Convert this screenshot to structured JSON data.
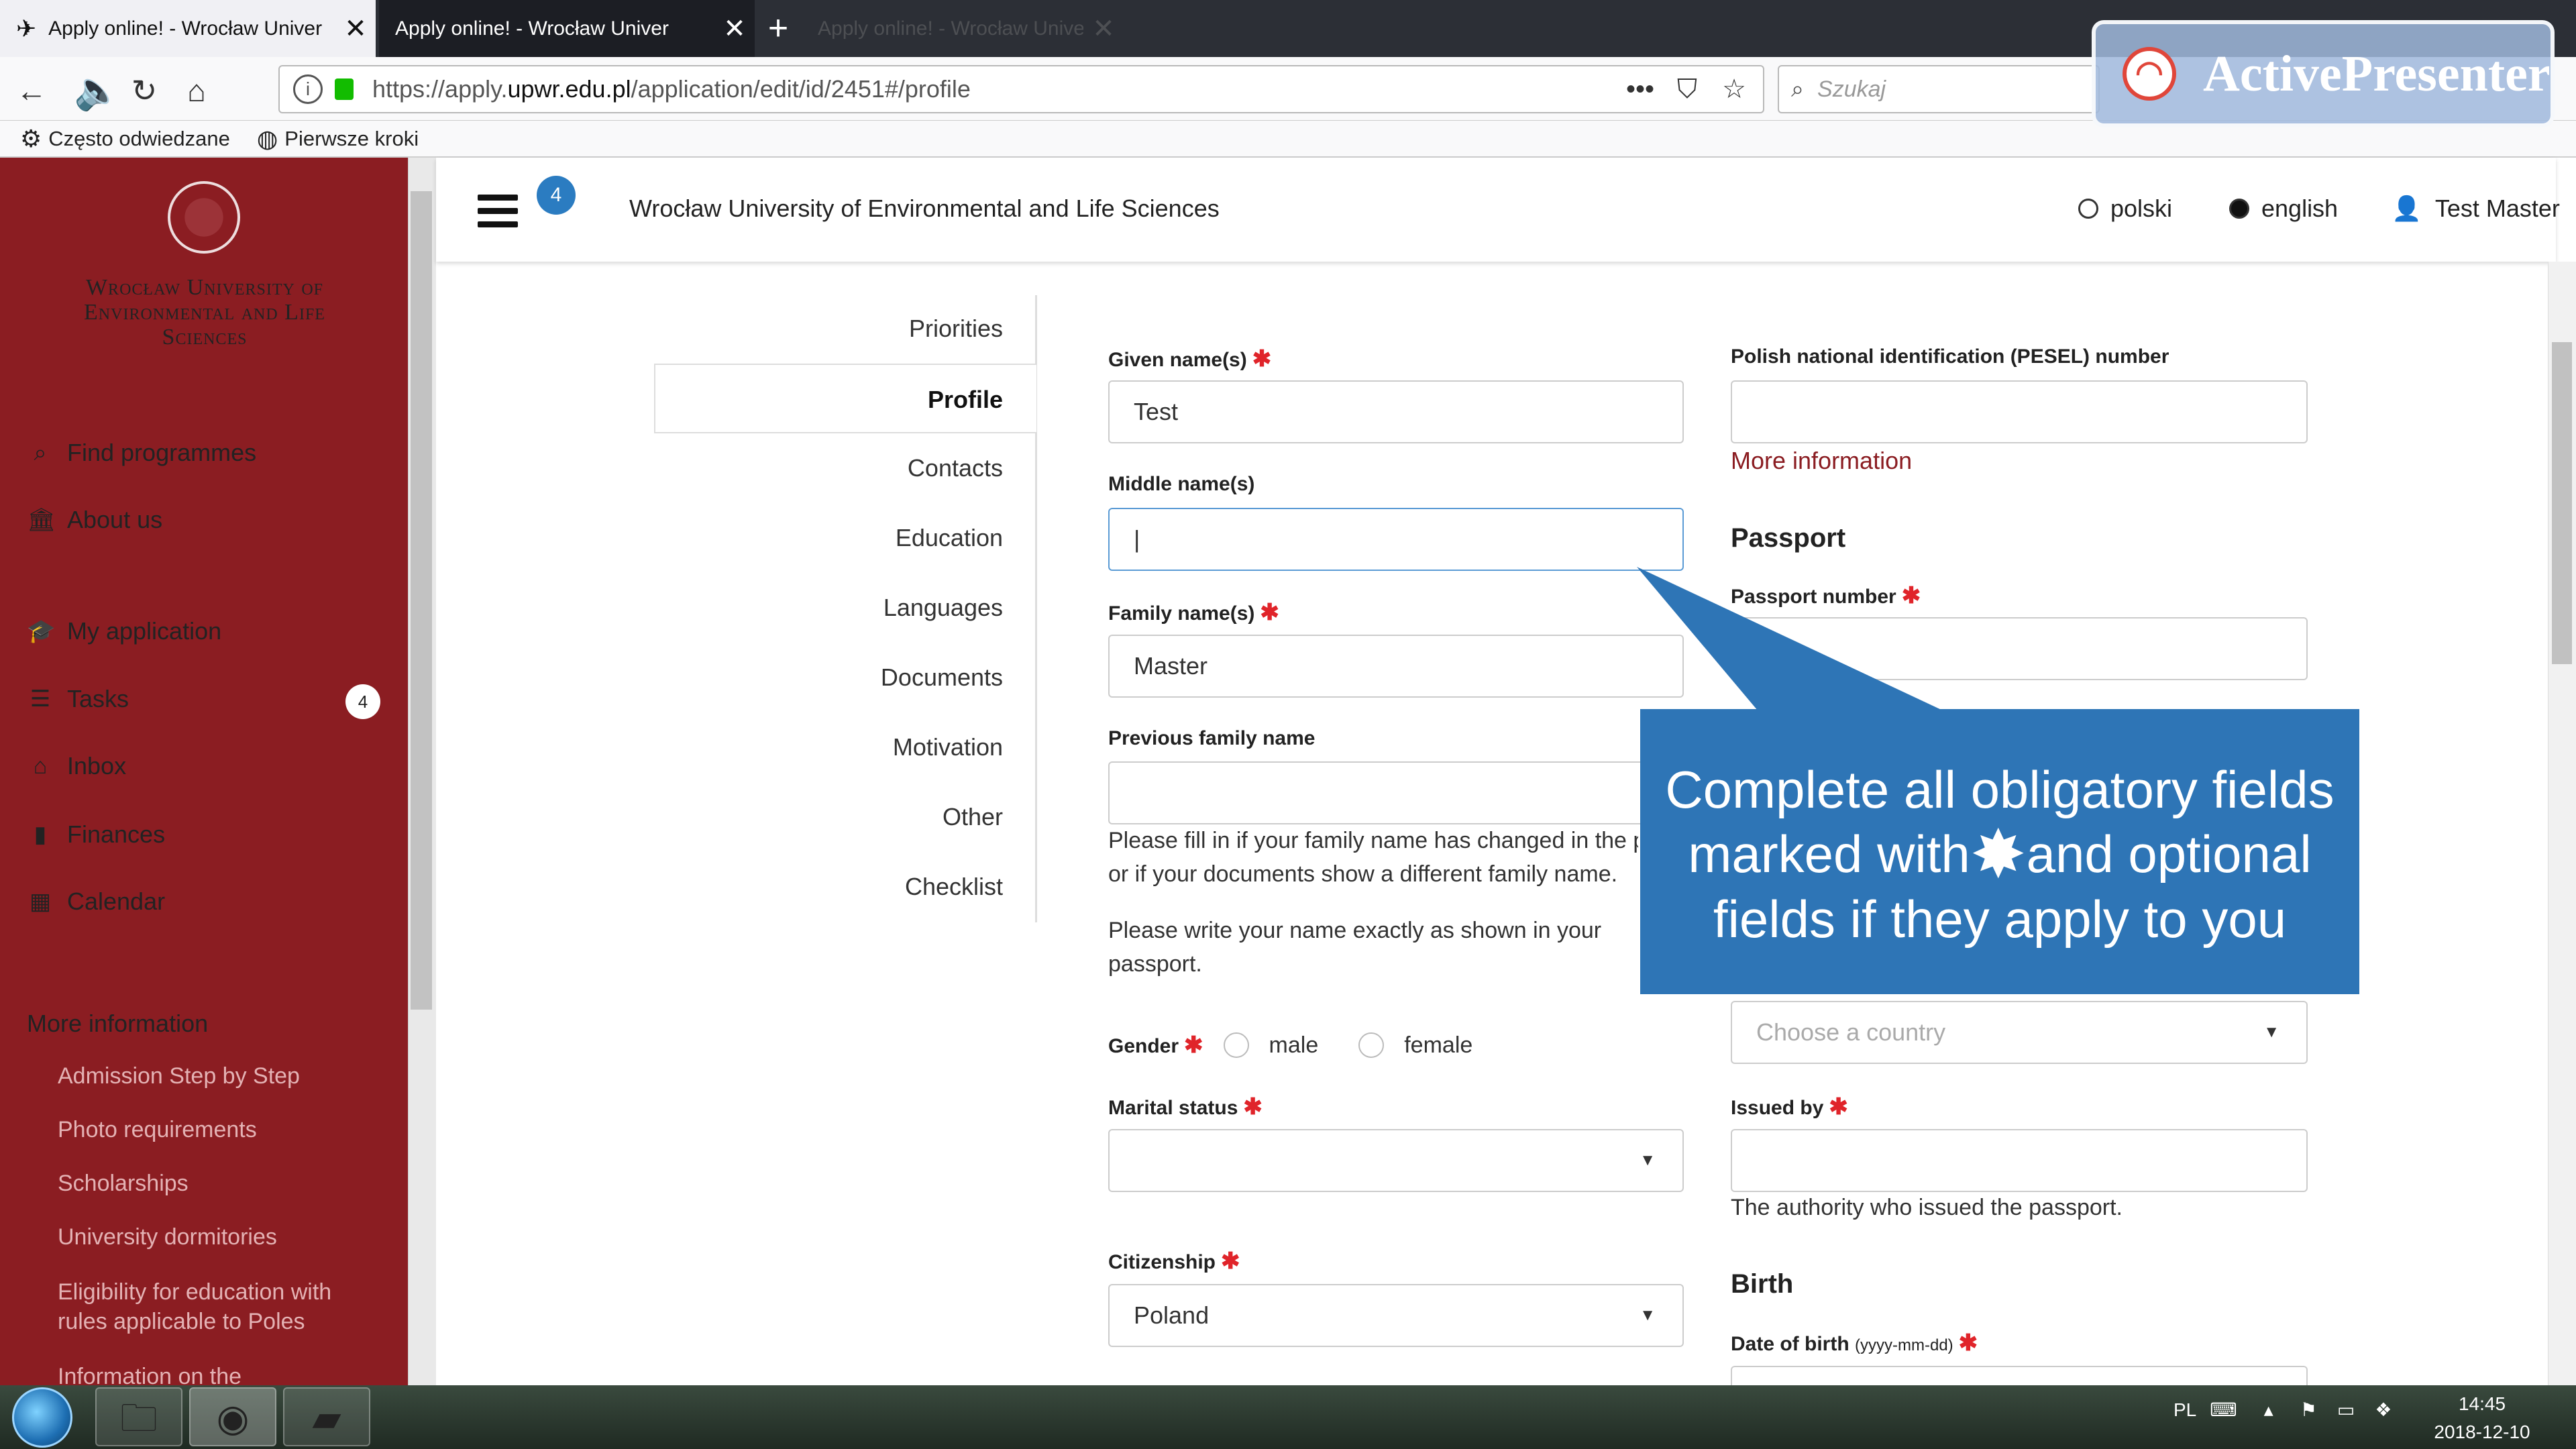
{
  "browser": {
    "tabs": [
      {
        "title": "Apply online! - Wrocław Univer",
        "close": "✕"
      },
      {
        "title": "Apply online! - Wrocław Univer",
        "close": "✕"
      },
      {
        "title": "Apply online! - Wrocław Unive",
        "close": "✕"
      }
    ],
    "new_tab": "+",
    "url_prefix": "https://apply.",
    "url_domain": "upwr.edu.pl",
    "url_path": "/application/edit/id/2451#/profile",
    "search_placeholder": "Szukaj",
    "bookmarks": [
      {
        "label": "Często odwiedzane",
        "icon": "gear-icon"
      },
      {
        "label": "Pierwsze kroki",
        "icon": "globe-icon"
      }
    ]
  },
  "watermark": {
    "text": "ActivePresenter"
  },
  "sidebar": {
    "university": "Wrocław University of Environmental and Life Sciences",
    "nav": [
      {
        "label": "Find programmes",
        "icon": "search-icon"
      },
      {
        "label": "About us",
        "icon": "bank-icon"
      },
      {
        "label": "My application",
        "icon": "graduation-cap-icon"
      },
      {
        "label": "Tasks",
        "icon": "tasks-icon",
        "badge": "4"
      },
      {
        "label": "Inbox",
        "icon": "inbox-icon"
      },
      {
        "label": "Finances",
        "icon": "file-icon"
      },
      {
        "label": "Calendar",
        "icon": "calendar-icon"
      }
    ],
    "more_info_title": "More information",
    "more_info": [
      "Admission Step by Step",
      "Photo requirements",
      "Scholarships",
      "University dormitories",
      "Eligibility for education with rules applicable to Poles",
      "Information on the"
    ]
  },
  "header": {
    "badge": "4",
    "title": "Wrocław University of Environmental and Life Sciences",
    "lang_polski": "polski",
    "lang_english": "english",
    "user": "Test Master"
  },
  "tabs": [
    "Priorities",
    "Profile",
    "Contacts",
    "Education",
    "Languages",
    "Documents",
    "Motivation",
    "Other",
    "Checklist"
  ],
  "form": {
    "given_name_label": "Given name(s)",
    "given_name_value": "Test",
    "middle_name_label": "Middle name(s)",
    "middle_name_value": "|",
    "family_name_label": "Family name(s)",
    "family_name_value": "Master",
    "previous_family_label": "Previous family name",
    "previous_family_help_1": "Please fill in if your family name has changed in the p",
    "previous_family_help_2": "or if your documents show a different family name.",
    "name_help_1": "Please write your name exactly as shown in your",
    "name_help_2": "passport.",
    "gender_label": "Gender",
    "gender_male": "male",
    "gender_female": "female",
    "marital_label": "Marital status",
    "citizenship_label": "Citizenship",
    "citizenship_value": "Poland",
    "pesel_label": "Polish national identification (PESEL) number",
    "more_information": "More information",
    "passport_title": "Passport",
    "passport_number_label": "Passport number",
    "country_placeholder": "Choose a country",
    "issued_by_label": "Issued by",
    "issued_by_help": "The authority who issued the passport.",
    "birth_title": "Birth",
    "dob_label": "Date of birth",
    "dob_hint": "(yyyy-mm-dd)",
    "required_mark": "✱"
  },
  "callout": {
    "line1": "Complete all obligatory fields",
    "line2a": "marked with",
    "star": "✸",
    "line2b": "and optional",
    "line3": "fields if they apply to you"
  },
  "taskbar": {
    "lang": "PL",
    "time": "14:45",
    "date": "2018-12-10"
  },
  "colors": {
    "sidebar": "#8b1d22",
    "accent": "#2b7cc1",
    "callout": "#2e75b6",
    "required": "#e0242a"
  }
}
